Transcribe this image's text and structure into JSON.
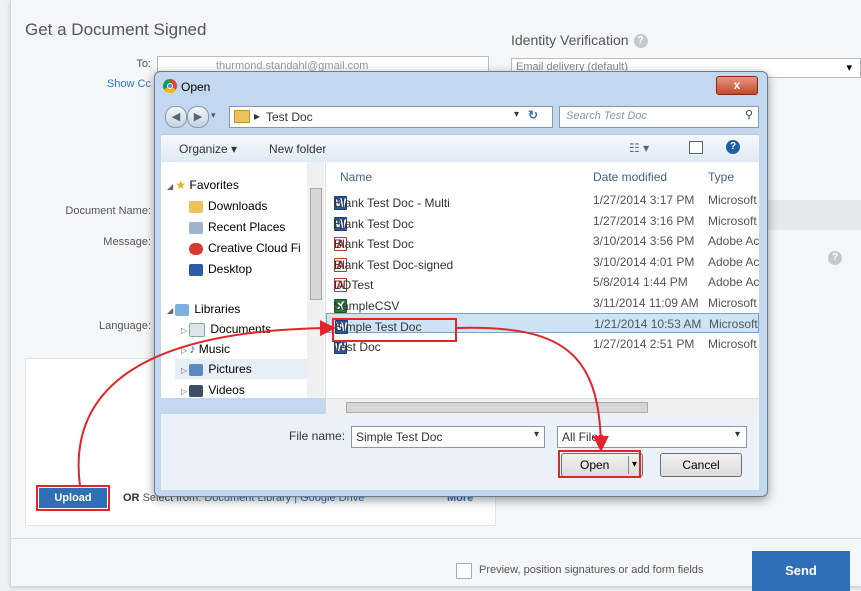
{
  "page": {
    "title": "Get a Document Signed",
    "identity_label": "Identity Verification",
    "identity_value": "Email delivery (default)",
    "to_label": "To:",
    "to_value": "thurmond.standahl@gmail.com",
    "show_cc": "Show Cc",
    "document_name_label": "Document Name:",
    "message_label": "Message:",
    "language_label": "Language:",
    "upload_label": "Upload",
    "or_text": "OR",
    "select_from_text": "Select from:",
    "doc_library_link": "Document Library",
    "google_drive_link": "Google Drive",
    "separator": "|",
    "more_link": "More",
    "preview_label": "Preview, position signatures or add form fields",
    "send_label": "Send",
    "help_glyph": "?"
  },
  "dialog": {
    "title": "Open",
    "close_glyph": "x",
    "address": "Test Doc",
    "address_sep": "▸",
    "search_placeholder": "Search Test Doc",
    "organize": "Organize ▾",
    "new_folder": "New folder",
    "nav": {
      "favorites": "Favorites",
      "downloads": "Downloads",
      "recent": "Recent Places",
      "creative_cloud": "Creative Cloud Fi",
      "desktop": "Desktop",
      "libraries": "Libraries",
      "documents": "Documents",
      "music": "Music",
      "pictures": "Pictures",
      "videos": "Videos"
    },
    "columns": {
      "name": "Name",
      "date": "Date modified",
      "type": "Type"
    },
    "files": [
      {
        "name": "Blank Test Doc - Multi",
        "date": "1/27/2014 3:17 PM",
        "type": "Microsoft",
        "icon": "word",
        "glyph": "W"
      },
      {
        "name": "Blank Test Doc",
        "date": "1/27/2014 3:16 PM",
        "type": "Microsoft",
        "icon": "word",
        "glyph": "W"
      },
      {
        "name": "Blank Test Doc",
        "date": "3/10/2014 3:56 PM",
        "type": "Adobe Ac",
        "icon": "pdf",
        "glyph": "A"
      },
      {
        "name": "Blank Test Doc-signed",
        "date": "3/10/2014 4:01 PM",
        "type": "Adobe Ac",
        "icon": "pdf",
        "glyph": "A"
      },
      {
        "name": "DDTest",
        "date": "5/8/2014 1:44 PM",
        "type": "Adobe Ac",
        "icon": "pdf",
        "glyph": "A"
      },
      {
        "name": "SampleCSV",
        "date": "3/11/2014 11:09 AM",
        "type": "Microsoft",
        "icon": "xls",
        "glyph": "X"
      },
      {
        "name": "Simple Test Doc",
        "date": "1/21/2014 10:53 AM",
        "type": "Microsoft",
        "icon": "word",
        "glyph": "W"
      },
      {
        "name": "Test Doc",
        "date": "1/27/2014 2:51 PM",
        "type": "Microsoft",
        "icon": "word",
        "glyph": "W"
      }
    ],
    "file_name_label": "File name:",
    "file_name_value": "Simple Test Doc",
    "file_type_value": "All Files",
    "open_label": "Open",
    "cancel_label": "Cancel"
  },
  "colors": {
    "accent": "#2f6fb7",
    "annotation": "#e0252b"
  }
}
